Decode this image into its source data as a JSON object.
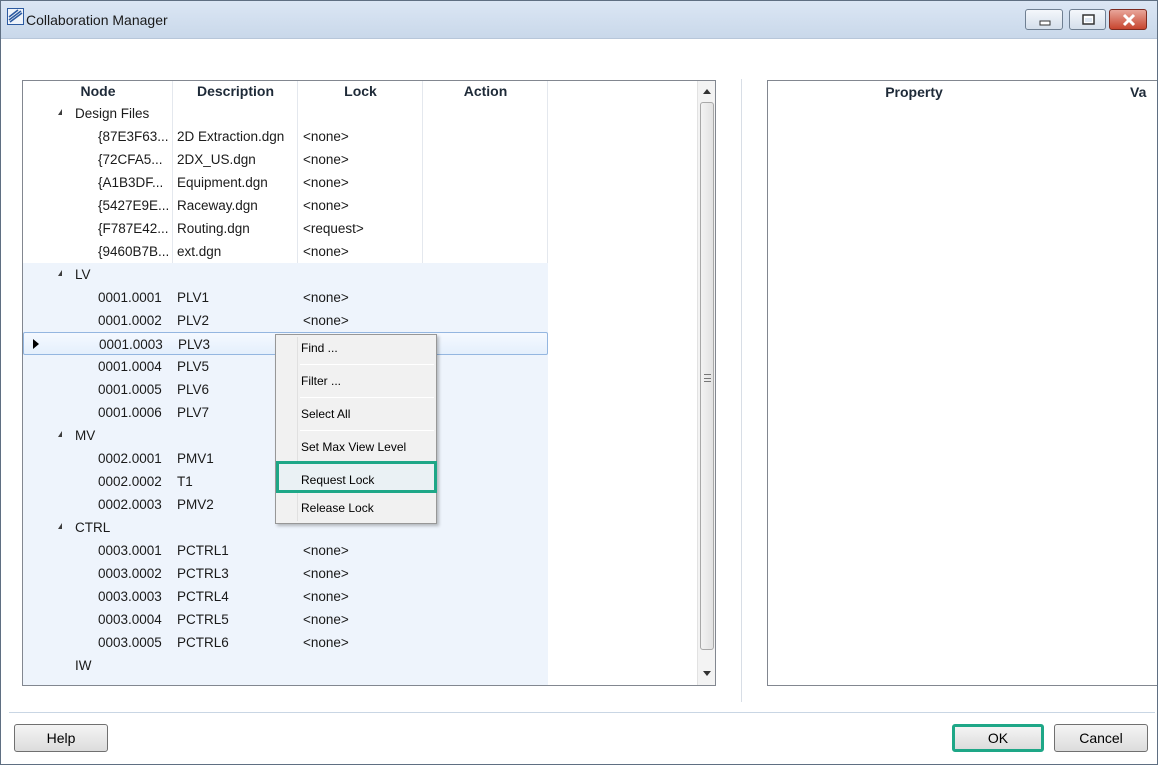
{
  "window": {
    "title": "Collaboration Manager"
  },
  "grid": {
    "headers": {
      "node": "Node",
      "description": "Description",
      "lock": "Lock",
      "action": "Action"
    },
    "rows": [
      {
        "type": "group",
        "node": "Design Files",
        "description": "",
        "lock": ""
      },
      {
        "type": "leaf",
        "node": "{87E3F63...",
        "description": "2D Extraction.dgn",
        "lock": "<none>"
      },
      {
        "type": "leaf",
        "node": "{72CFA5...",
        "description": "2DX_US.dgn",
        "lock": "<none>"
      },
      {
        "type": "leaf",
        "node": "{A1B3DF...",
        "description": "Equipment.dgn",
        "lock": "<none>"
      },
      {
        "type": "leaf",
        "node": "{5427E9E...",
        "description": "Raceway.dgn",
        "lock": "<none>"
      },
      {
        "type": "leaf",
        "node": "{F787E42...",
        "description": "Routing.dgn",
        "lock": "<request>"
      },
      {
        "type": "leaf",
        "node": "{9460B7B...",
        "description": "ext.dgn",
        "lock": "<none>"
      },
      {
        "type": "group",
        "node": "LV",
        "description": "",
        "lock": ""
      },
      {
        "type": "leaf",
        "node": "0001.0001",
        "description": "PLV1",
        "lock": "<none>"
      },
      {
        "type": "leaf",
        "node": "0001.0002",
        "description": "PLV2",
        "lock": "<none>"
      },
      {
        "type": "leaf",
        "node": "0001.0003",
        "description": "PLV3",
        "lock": ""
      },
      {
        "type": "leaf",
        "node": "0001.0004",
        "description": "PLV5",
        "lock": ""
      },
      {
        "type": "leaf",
        "node": "0001.0005",
        "description": "PLV6",
        "lock": ""
      },
      {
        "type": "leaf",
        "node": "0001.0006",
        "description": "PLV7",
        "lock": ""
      },
      {
        "type": "group",
        "node": "MV",
        "description": "",
        "lock": ""
      },
      {
        "type": "leaf",
        "node": "0002.0001",
        "description": "PMV1",
        "lock": ""
      },
      {
        "type": "leaf",
        "node": "0002.0002",
        "description": "T1",
        "lock": ""
      },
      {
        "type": "leaf",
        "node": "0002.0003",
        "description": "PMV2",
        "lock": ""
      },
      {
        "type": "group",
        "node": "CTRL",
        "description": "",
        "lock": ""
      },
      {
        "type": "leaf",
        "node": "0003.0001",
        "description": "PCTRL1",
        "lock": "<none>"
      },
      {
        "type": "leaf",
        "node": "0003.0002",
        "description": "PCTRL3",
        "lock": "<none>"
      },
      {
        "type": "leaf",
        "node": "0003.0003",
        "description": "PCTRL4",
        "lock": "<none>"
      },
      {
        "type": "leaf",
        "node": "0003.0004",
        "description": "PCTRL5",
        "lock": "<none>"
      },
      {
        "type": "leaf",
        "node": "0003.0005",
        "description": "PCTRL6",
        "lock": "<none>"
      },
      {
        "type": "group-noexpand",
        "node": "IW",
        "description": "",
        "lock": ""
      }
    ],
    "selected_row_index": 10
  },
  "properties": {
    "headers": {
      "property": "Property",
      "value": "Va"
    }
  },
  "context_menu": {
    "items": [
      "Find ...",
      "Filter ...",
      "Select All",
      "Set Max View Level",
      "Request Lock",
      "Release Lock"
    ],
    "highlighted": "Request Lock"
  },
  "buttons": {
    "help": "Help",
    "ok": "OK",
    "cancel": "Cancel"
  },
  "colors": {
    "highlight_border": "#1ea787",
    "selection": "#94b6e0"
  }
}
